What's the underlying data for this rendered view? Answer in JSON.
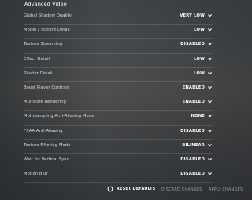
{
  "section": {
    "title": "Advanced Video"
  },
  "settings": [
    {
      "label": "Global Shadow Quality",
      "value": "VERY LOW"
    },
    {
      "label": "Model / Texture Detail",
      "value": "LOW"
    },
    {
      "label": "Texture Streaming",
      "value": "DISABLED"
    },
    {
      "label": "Effect Detail",
      "value": "LOW"
    },
    {
      "label": "Shader Detail",
      "value": "LOW"
    },
    {
      "label": "Boost Player Contrast",
      "value": "ENABLED"
    },
    {
      "label": "Multicore Rendering",
      "value": "ENABLED"
    },
    {
      "label": "Multisampling Anti-Aliasing Mode",
      "value": "NONE"
    },
    {
      "label": "FXAA Anti-Aliasing",
      "value": "DISABLED"
    },
    {
      "label": "Texture Filtering Mode",
      "value": "BILINEAR"
    },
    {
      "label": "Wait for Vertical Sync",
      "value": "DISABLED"
    },
    {
      "label": "Motion Blur",
      "value": "DISABLED"
    }
  ],
  "footer": {
    "reset_label": "RESET DEFAULTS",
    "discard_label": "DISCARD CHANGES",
    "apply_label": "APPLY CHANGES"
  },
  "icons": {
    "dropdown": "chevron-down-icon",
    "reset": "reset-arrow-icon"
  },
  "colors": {
    "label": "#dcdcdc",
    "value": "#ffffff",
    "disabled_button": "#9a9a9a"
  }
}
